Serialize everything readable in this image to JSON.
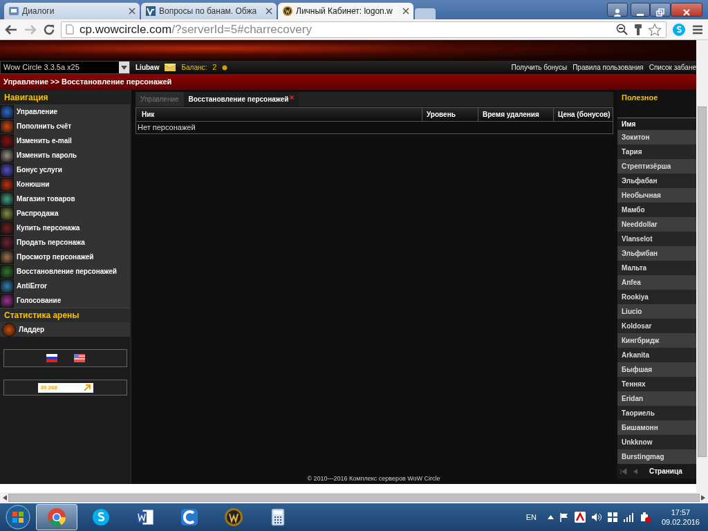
{
  "browser": {
    "tabs": [
      {
        "title": "Диалоги",
        "kind": "chat",
        "selected": false
      },
      {
        "title": "Вопросы по банам. Обжа",
        "kind": "forum",
        "selected": false
      },
      {
        "title": "Личный Кабинет: logon.w",
        "kind": "game",
        "selected": true
      }
    ],
    "address": {
      "host": "cp.wowcircle.com",
      "path": "/?serverId=5#charrecovery"
    }
  },
  "topbar": {
    "server": "Wow Circle 3.3.5a x25",
    "user": "Liubaw",
    "balance_label": "Баланс:",
    "balance": "2",
    "links": [
      "Получить бонусы",
      "Правила пользования",
      "Список забане"
    ]
  },
  "breadcrumb": "Управление >> Восстановление персонажей",
  "navigation": {
    "title": "Навигация",
    "items": [
      "Управление",
      "Пополнить счёт",
      "Изменить e-mail",
      "Изменить пароль",
      "Бонус услуги",
      "Конюшни",
      "Магазин товаров",
      "Распродажа",
      "Купить персонажа",
      "Продать персонажа",
      "Просмотр персонажей",
      "Восстановление персонажей",
      "AntiError",
      "Голосование"
    ]
  },
  "arena": {
    "title": "Статистика арены",
    "items": [
      "Ладдер"
    ]
  },
  "counter": "30 268",
  "content": {
    "tabs": [
      {
        "label": "Управление",
        "selected": false,
        "closable": false
      },
      {
        "label": "Восстановление персонажей",
        "selected": true,
        "closable": true
      }
    ],
    "columns": [
      "Ник",
      "Уровень",
      "Время удаления",
      "Цена (бонусов)"
    ],
    "empty_text": "Нет персонажей"
  },
  "useful": {
    "title": "Полезное",
    "column": "Имя",
    "names": [
      "Зокитон",
      "Тария",
      "Стрептизёрша",
      "Эльфабан",
      "Необычная",
      "Мамбо",
      "Needdollar",
      "Vlanselot",
      "Эльфибан",
      "Мальта",
      "Anfea",
      "Rookiya",
      "Liucio",
      "Koldosar",
      "Кингбридж",
      "Arkanita",
      "Быфшая",
      "Теннях",
      "Eridan",
      "Таориель",
      "Бишамонн",
      "Unkknow",
      "Burstingmag"
    ],
    "pager_label": "Страница"
  },
  "footer": "© 2010—2016 Комплекс серверов WoW Circle",
  "taskbar": {
    "apps": [
      {
        "kind": "chrome",
        "selected": true
      },
      {
        "kind": "skype",
        "selected": false
      },
      {
        "kind": "word",
        "selected": false
      },
      {
        "kind": "c",
        "selected": false
      },
      {
        "kind": "wow",
        "selected": false
      },
      {
        "kind": "calc",
        "selected": false
      }
    ],
    "lang": "EN",
    "time": "17:57",
    "date": "09.02.2016"
  }
}
